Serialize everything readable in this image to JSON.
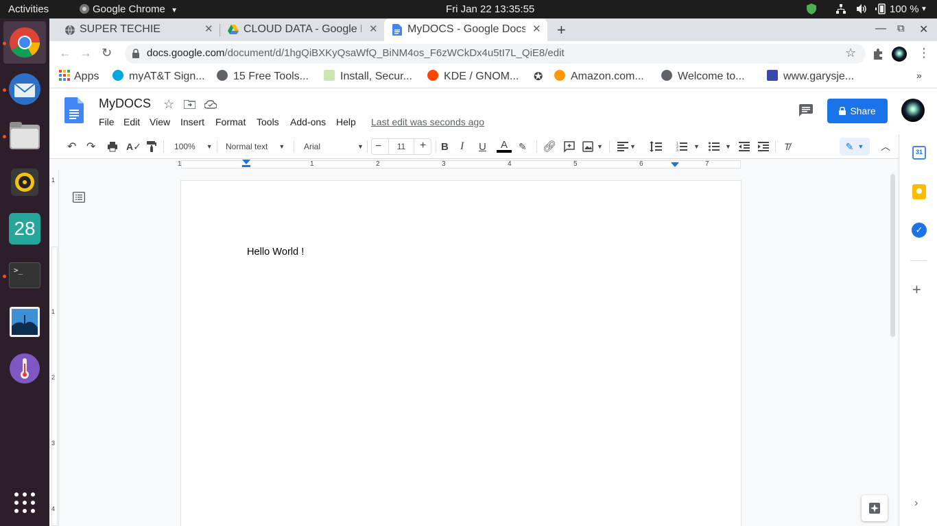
{
  "system": {
    "activities": "Activities",
    "app_name": "Google Chrome",
    "datetime": "Fri Jan 22  13:35:55",
    "battery": "100 %"
  },
  "dock": {
    "calendar_day": "28",
    "items": [
      "chrome-icon",
      "thunderbird-icon",
      "files-icon",
      "rhythmbox-icon",
      "calendar-icon",
      "terminal-icon",
      "image-viewer-icon",
      "thermometer-icon",
      "app-grid-icon"
    ]
  },
  "tabs": [
    {
      "label": "SUPER TECHIE"
    },
    {
      "label": "CLOUD DATA - Google D"
    },
    {
      "label": "MyDOCS - Google Docs"
    }
  ],
  "address": {
    "host": "docs.google.com",
    "path": "/document/d/1hgQiBXKyQsaWfQ_BiNM4os_F6zWCkDx4u5tI7L_QiE8/edit"
  },
  "bookmarks": [
    {
      "label": "Apps"
    },
    {
      "label": "myAT&T Sign..."
    },
    {
      "label": "15 Free Tools..."
    },
    {
      "label": "Install, Secur..."
    },
    {
      "label": "KDE / GNOM..."
    },
    {
      "label": "Amazon.com..."
    },
    {
      "label": "Welcome to..."
    },
    {
      "label": "www.garysje..."
    }
  ],
  "doc": {
    "title": "MyDOCS",
    "menus": [
      "File",
      "Edit",
      "View",
      "Insert",
      "Format",
      "Tools",
      "Add-ons",
      "Help"
    ],
    "last_edit": "Last edit was seconds ago",
    "share_label": "Share",
    "body_text": "Hello World !"
  },
  "toolbar": {
    "zoom": "100%",
    "style": "Normal text",
    "font": "Arial",
    "font_size": "11"
  },
  "ruler": {
    "h_labels": [
      "1",
      "1",
      "2",
      "3",
      "4",
      "5",
      "6",
      "7"
    ],
    "v_labels": [
      "1",
      "1",
      "2",
      "3",
      "4"
    ]
  },
  "colors": {
    "share_blue": "#1a73e8",
    "docs_blue": "#4285f4",
    "dock_bg": "#2c1f2b",
    "ubuntu_orange": "#e95420"
  }
}
